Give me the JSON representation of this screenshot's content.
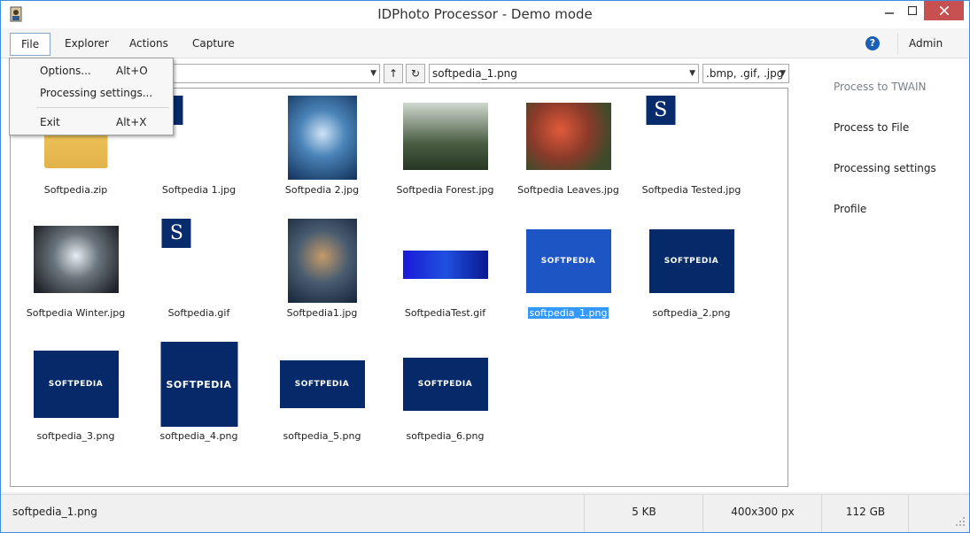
{
  "window": {
    "title": "IDPhoto Processor - Demo mode"
  },
  "menubar": {
    "items": [
      "File",
      "Explorer",
      "Actions",
      "Capture"
    ],
    "admin": "Admin"
  },
  "file_menu": {
    "items": [
      {
        "label": "Options...",
        "shortcut": "Alt+O"
      },
      {
        "label": "Processing settings...",
        "shortcut": ""
      },
      {
        "label": "Exit",
        "shortcut": "Alt+X"
      }
    ]
  },
  "toolbar": {
    "file_combo": "softpedia_1.png",
    "filter_combo": ".bmp, .gif, .jpg"
  },
  "files": [
    {
      "name": "Softpedia.zip",
      "kind": "zip"
    },
    {
      "name": "Softpedia 1.jpg",
      "kind": "s-logo"
    },
    {
      "name": "Softpedia 2.jpg",
      "kind": "art"
    },
    {
      "name": "Softpedia Forest.jpg",
      "kind": "forest"
    },
    {
      "name": "Softpedia Leaves.jpg",
      "kind": "leaves"
    },
    {
      "name": "Softpedia Tested.jpg",
      "kind": "s-logo"
    },
    {
      "name": "Softpedia Winter.jpg",
      "kind": "winter"
    },
    {
      "name": "Softpedia.gif",
      "kind": "s-logo"
    },
    {
      "name": "Softpedia1.jpg",
      "kind": "art"
    },
    {
      "name": "SoftpediaTest.gif",
      "kind": "banner"
    },
    {
      "name": "softpedia_1.png",
      "kind": "logo",
      "selected": true
    },
    {
      "name": "softpedia_2.png",
      "kind": "logo"
    },
    {
      "name": "softpedia_3.png",
      "kind": "logo"
    },
    {
      "name": "softpedia_4.png",
      "kind": "logo"
    },
    {
      "name": "softpedia_5.png",
      "kind": "logo"
    },
    {
      "name": "softpedia_6.png",
      "kind": "logo"
    }
  ],
  "logo_text": "SOFTPEDIA",
  "sidebar": {
    "items": [
      {
        "label": "Process to TWAIN",
        "disabled": true
      },
      {
        "label": "Process to File",
        "disabled": false
      },
      {
        "label": "Processing settings",
        "disabled": false
      },
      {
        "label": "Profile",
        "disabled": false
      }
    ]
  },
  "status": {
    "filename": "softpedia_1.png",
    "size": "5 KB",
    "dimensions": "400x300 px",
    "free": "112 GB"
  }
}
